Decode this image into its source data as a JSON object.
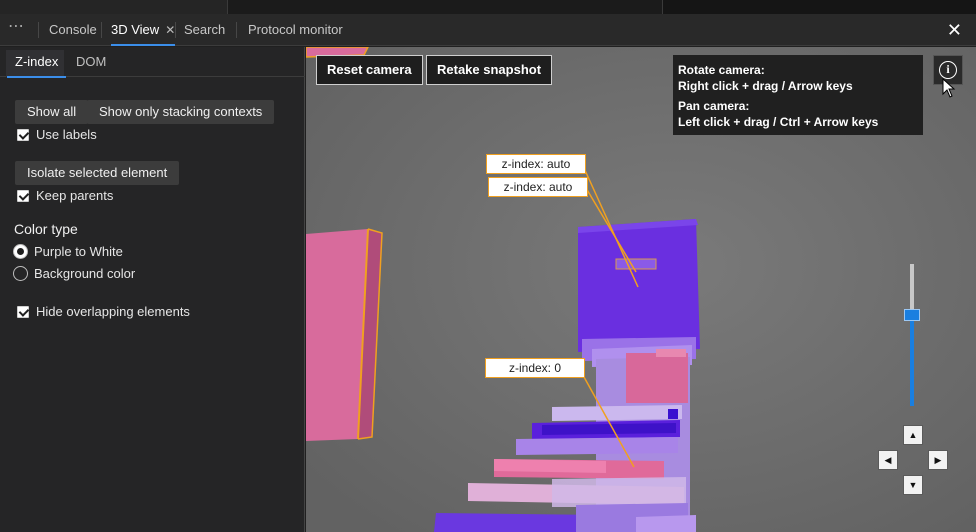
{
  "tabbar": {
    "more_icon": "⋯",
    "tabs": [
      {
        "label": "Console"
      },
      {
        "label": "3D View",
        "active": true,
        "close_icon": "✕"
      },
      {
        "label": "Search"
      },
      {
        "label": "Protocol monitor"
      }
    ],
    "close_icon": "✕"
  },
  "sidebar": {
    "subtabs": [
      {
        "label": "Z-index",
        "active": true
      },
      {
        "label": "DOM"
      }
    ],
    "show_all_label": "Show all",
    "show_stacking_label": "Show only stacking contexts",
    "use_labels_label": "Use labels",
    "use_labels_checked": true,
    "isolate_label": "Isolate selected element",
    "keep_parents_label": "Keep parents",
    "keep_parents_checked": true,
    "color_type_heading": "Color type",
    "color_options": [
      {
        "label": "Purple to White",
        "selected": true
      },
      {
        "label": "Background color",
        "selected": false
      }
    ],
    "hide_overlapping_label": "Hide overlapping elements",
    "hide_overlapping_checked": true
  },
  "view": {
    "reset_camera_label": "Reset camera",
    "retake_snapshot_label": "Retake snapshot",
    "help": {
      "rotate_title": "Rotate camera:",
      "rotate_keys": "Right click + drag / Arrow keys",
      "pan_title": "Pan camera:",
      "pan_keys": "Left click + drag / Ctrl + Arrow keys"
    },
    "info_icon": "i",
    "zindex_labels": [
      "z-index: auto",
      "z-index: auto",
      "z-index: 0"
    ],
    "zoom_level": 0.64,
    "arrows": {
      "up": "▲",
      "left": "◀",
      "right": "▶",
      "down": "▼"
    },
    "colors": {
      "accent": "#3b8eea",
      "label_border": "#f0a020",
      "purple": "#6a2fe0",
      "pink": "#e06a9a"
    }
  }
}
